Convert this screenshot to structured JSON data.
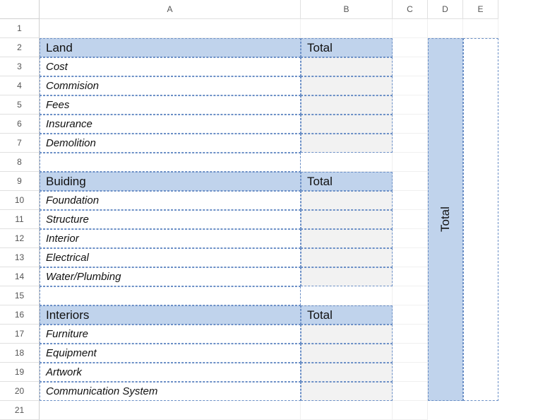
{
  "columns": [
    "A",
    "B",
    "C",
    "D",
    "E"
  ],
  "rows": [
    "1",
    "2",
    "3",
    "4",
    "5",
    "6",
    "7",
    "8",
    "9",
    "10",
    "11",
    "12",
    "13",
    "14",
    "15",
    "16",
    "17",
    "18",
    "19",
    "20",
    "21"
  ],
  "sections": {
    "land": {
      "title": "Land",
      "total_label": "Total",
      "items": [
        "Cost",
        "Commision",
        "Fees",
        "Insurance",
        "Demolition"
      ]
    },
    "building": {
      "title": "Buiding",
      "total_label": "Total",
      "items": [
        "Foundation",
        "Structure",
        "Interior",
        "Electrical",
        "Water/Plumbing"
      ]
    },
    "interiors": {
      "title": "Interiors",
      "total_label": "Total",
      "items": [
        "Furniture",
        "Equipment",
        "Artwork",
        "Communication System"
      ]
    }
  },
  "vertical_total": "Total"
}
